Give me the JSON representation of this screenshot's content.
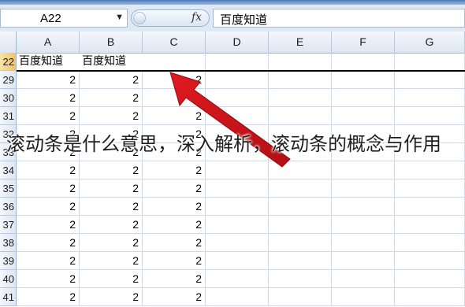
{
  "formula_bar": {
    "name_box_value": "A22",
    "name_box_arrow": "▼",
    "fx_label": "fx",
    "formula_value": "百度知道"
  },
  "columns": [
    "A",
    "B",
    "C",
    "D",
    "E",
    "F",
    "G"
  ],
  "rows": [
    {
      "num": "22",
      "cells": [
        "百度知道",
        "百度知道",
        "",
        "",
        "",
        "",
        ""
      ]
    },
    {
      "num": "29",
      "cells": [
        "2",
        "2",
        "2",
        "",
        "",
        "",
        ""
      ]
    },
    {
      "num": "30",
      "cells": [
        "2",
        "2",
        "2",
        "",
        "",
        "",
        ""
      ]
    },
    {
      "num": "31",
      "cells": [
        "2",
        "2",
        "2",
        "",
        "",
        "",
        ""
      ]
    },
    {
      "num": "32",
      "cells": [
        "2",
        "2",
        "2",
        "",
        "",
        "",
        ""
      ]
    },
    {
      "num": "33",
      "cells": [
        "2",
        "2",
        "2",
        "",
        "",
        "",
        ""
      ]
    },
    {
      "num": "34",
      "cells": [
        "2",
        "2",
        "2",
        "",
        "",
        "",
        ""
      ]
    },
    {
      "num": "35",
      "cells": [
        "2",
        "2",
        "2",
        "",
        "",
        "",
        ""
      ]
    },
    {
      "num": "36",
      "cells": [
        "2",
        "2",
        "2",
        "",
        "",
        "",
        ""
      ]
    },
    {
      "num": "37",
      "cells": [
        "2",
        "2",
        "2",
        "",
        "",
        "",
        ""
      ]
    },
    {
      "num": "38",
      "cells": [
        "2",
        "2",
        "2",
        "",
        "",
        "",
        ""
      ]
    },
    {
      "num": "39",
      "cells": [
        "2",
        "2",
        "2",
        "",
        "",
        "",
        ""
      ]
    },
    {
      "num": "40",
      "cells": [
        "2",
        "2",
        "2",
        "",
        "",
        "",
        ""
      ]
    },
    {
      "num": "41",
      "cells": [
        "2",
        "2",
        "2",
        "",
        "",
        "",
        ""
      ]
    }
  ],
  "overlay_caption": "滚动条是什么意思，深入解析，滚动条的概念与作用",
  "colors": {
    "arrow": "#d8161b",
    "header_selected": "#f2c35f",
    "gridline": "#d0d7e5"
  }
}
